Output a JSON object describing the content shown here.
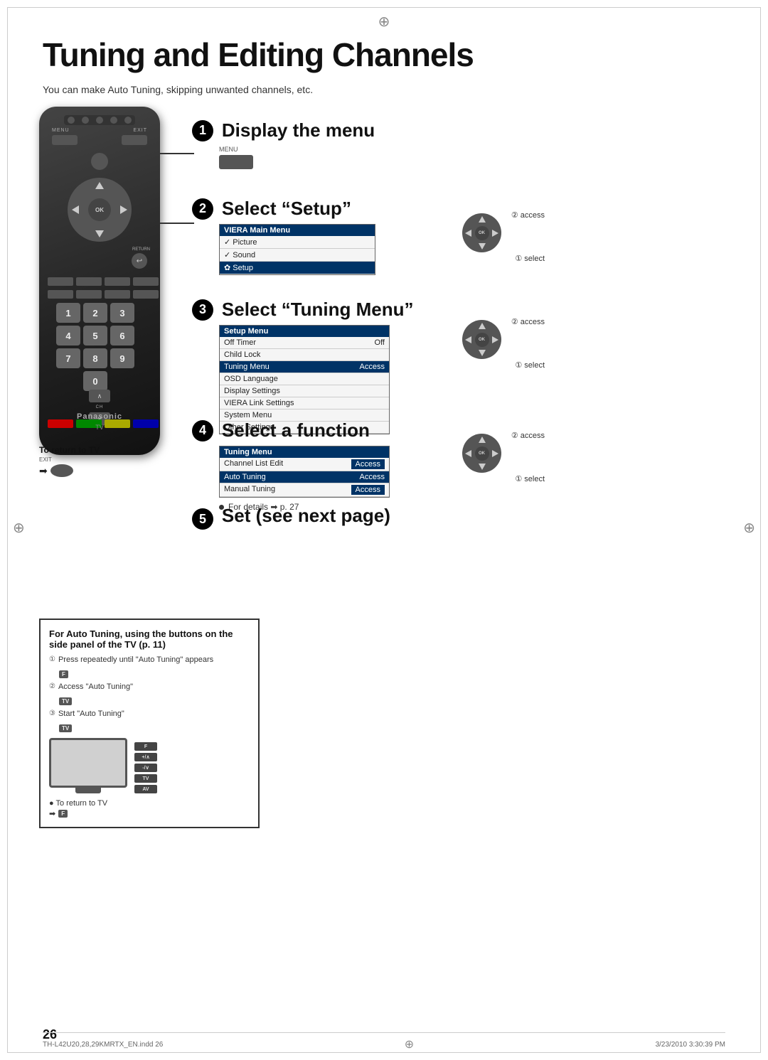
{
  "page": {
    "title": "Tuning and Editing Channels",
    "subtitle": "You can make Auto Tuning, skipping unwanted channels, etc.",
    "page_number": "26",
    "footer_left": "TH-L42U20,28,29KMRTX_EN.indd  26",
    "footer_right": "3/23/2010  3:30:39 PM"
  },
  "steps": [
    {
      "number": "1",
      "title": "Display the menu",
      "label": "MENU"
    },
    {
      "number": "2",
      "title": "Select “Setup”",
      "menu_header": "VIERA Main Menu",
      "menu_items": [
        {
          "label": "Picture",
          "value": "",
          "selected": false
        },
        {
          "label": "Sound",
          "value": "",
          "selected": false
        },
        {
          "label": "Setup",
          "value": "",
          "selected": true
        }
      ],
      "access_label": "② access",
      "select_label": "① select"
    },
    {
      "number": "3",
      "title": "Select “Tuning Menu”",
      "menu_header": "Setup Menu",
      "menu_items": [
        {
          "label": "Off Timer",
          "value": "Off",
          "selected": false
        },
        {
          "label": "Child Lock",
          "value": "",
          "selected": false
        },
        {
          "label": "Tuning Menu",
          "value": "Access",
          "selected": true
        },
        {
          "label": "OSD Language",
          "value": "",
          "selected": false
        },
        {
          "label": "Display Settings",
          "value": "",
          "selected": false
        },
        {
          "label": "VIERA Link Settings",
          "value": "",
          "selected": false
        },
        {
          "label": "System Menu",
          "value": "",
          "selected": false
        },
        {
          "label": "Other Settings",
          "value": "",
          "selected": false
        }
      ],
      "access_label": "② access",
      "select_label": "① select"
    },
    {
      "number": "4",
      "title": "Select a function",
      "menu_header": "Tuning Menu",
      "menu_items": [
        {
          "label": "Channel List Edit",
          "value": "Access",
          "selected": false
        },
        {
          "label": "Auto Tuning",
          "value": "Access",
          "selected": true
        },
        {
          "label": "Manual Tuning",
          "value": "Access",
          "selected": false
        }
      ],
      "bullet": "For details ➡ p. 27",
      "access_label": "② access",
      "select_label": "① select"
    },
    {
      "number": "5",
      "title": "Set (see next page)"
    }
  ],
  "return_to_tv": {
    "label": "To return to TV",
    "exit_label": "EXIT",
    "arrow": "➡"
  },
  "info_box": {
    "title": "For Auto Tuning, using the buttons on the side panel of the TV (p. 11)",
    "steps": [
      {
        "number": "①",
        "text": "Press repeatedly until \"Auto Tuning\" appears",
        "key": "F"
      },
      {
        "number": "②",
        "text": "Access \"Auto Tuning\"",
        "key": "TV"
      },
      {
        "number": "③",
        "text": "Start \"Auto Tuning\"",
        "key": "TV"
      }
    ],
    "return_label": "● To return to TV",
    "return_key": "F"
  },
  "remote": {
    "menu_label": "MENU",
    "exit_label": "EXIT",
    "return_label": "RETURN",
    "ch_label": "CH",
    "brand": "Panasonic",
    "tv_label": "TV",
    "numpad": [
      "1",
      "2",
      "3",
      "4",
      "5",
      "6",
      "7",
      "8",
      "9",
      "0"
    ],
    "ok_label": "OK"
  },
  "icons": {
    "crosshair": "⊕",
    "bullet": "●",
    "arrow_right": "➡"
  }
}
